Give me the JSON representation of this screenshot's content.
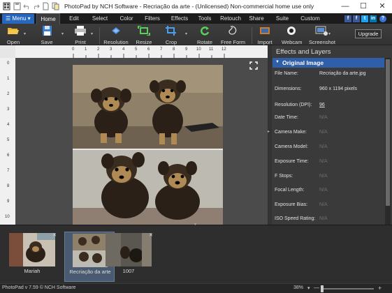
{
  "window": {
    "title": "PhotoPad by NCH Software - Recriação da arte - (Unlicensed) Non-commercial home use only",
    "controls": {
      "minimize": "—",
      "maximize": "☐",
      "close": "✕"
    }
  },
  "menubar": {
    "menu_label": "Menu",
    "tabs": [
      "Home",
      "Edit",
      "Select",
      "Color",
      "Filters",
      "Effects",
      "Tools",
      "Retouch",
      "Share",
      "Suite",
      "Custom"
    ],
    "active_tab": "Home",
    "help": "?"
  },
  "toolbar": {
    "open": "Open",
    "save": "Save",
    "print": "Print",
    "resolution": "Resolution",
    "resize": "Resize",
    "crop": "Crop",
    "rotate": "Rotate",
    "free_form": "Free Form",
    "import": "Import",
    "webcam": "Webcam",
    "screenshot": "Screenshot",
    "upgrade": "Upgrade"
  },
  "ruler": {
    "top": [
      "0",
      "1",
      "2",
      "3",
      "4",
      "5",
      "6",
      "7",
      "8",
      "9",
      "10",
      "11",
      "12"
    ],
    "left": [
      "0",
      "1",
      "2",
      "3",
      "4",
      "5",
      "6",
      "7",
      "8",
      "9",
      "10"
    ]
  },
  "panel": {
    "title": "Effects and Layers",
    "section": "Original Image",
    "rows": [
      {
        "key": "File Name:",
        "value": "Recriação da arte.jpg",
        "na": false
      },
      {
        "key": "Dimensions:",
        "value": "960 x 1194 pixels",
        "na": false
      },
      {
        "key": "Resolution (DPI):",
        "value": "96",
        "na": false
      },
      {
        "key": "Date Time:",
        "value": "N/A",
        "na": true
      },
      {
        "key": "Camera Make:",
        "value": "N/A",
        "na": true
      },
      {
        "key": "Camera Model:",
        "value": "N/A",
        "na": true
      },
      {
        "key": "Exposure Time:",
        "value": "N/A",
        "na": true
      },
      {
        "key": "F Stops:",
        "value": "N/A",
        "na": true
      },
      {
        "key": "Focal Length:",
        "value": "N/A",
        "na": true
      },
      {
        "key": "Exposure Bias:",
        "value": "N/A",
        "na": true
      },
      {
        "key": "ISO Speed Rating:",
        "value": "N/A",
        "na": true
      }
    ]
  },
  "filmstrip": {
    "items": [
      {
        "label": "Mariah",
        "selected": false
      },
      {
        "label": "Recriação da arte",
        "selected": true
      },
      {
        "label": "1007",
        "selected": false
      }
    ]
  },
  "status": {
    "text": "PhotoPad v 7.59 © NCH Software",
    "zoom": "38%",
    "zoom_minus": "—",
    "zoom_plus": "+"
  },
  "colors": {
    "accent": "#2767c0",
    "panel_header": "#2f5fa8",
    "background": "#2b2b2b"
  }
}
